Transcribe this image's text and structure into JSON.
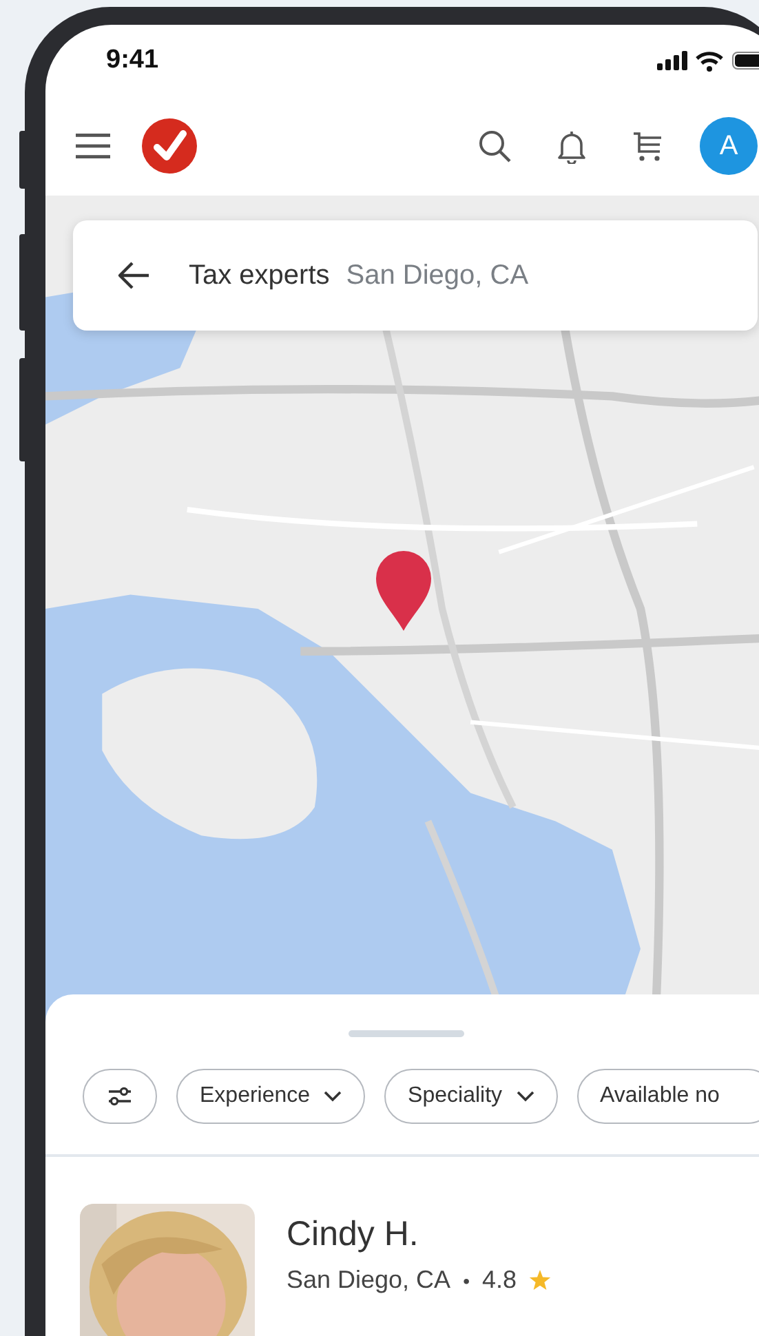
{
  "status_bar": {
    "time": "9:41"
  },
  "app_bar": {
    "avatar_initial": "A"
  },
  "search": {
    "query": "Tax experts",
    "location": "San Diego, CA"
  },
  "filters": [
    {
      "kind": "icon"
    },
    {
      "kind": "dropdown",
      "label": "Experience"
    },
    {
      "kind": "dropdown",
      "label": "Speciality"
    },
    {
      "kind": "chip",
      "label": "Available no"
    }
  ],
  "experts": [
    {
      "name": "Cindy H.",
      "location": "San Diego, CA",
      "separator": "•",
      "rating": "4.8"
    }
  ]
}
